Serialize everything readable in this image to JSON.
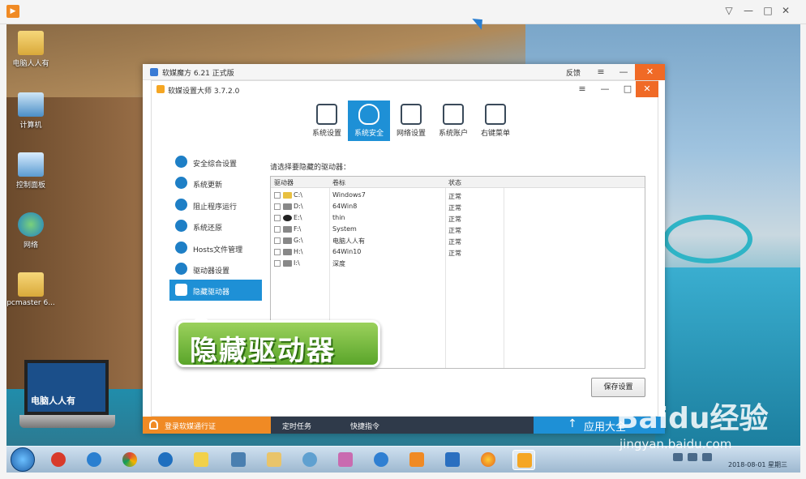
{
  "desktop": {
    "icons": [
      {
        "label": "电脑人人有"
      },
      {
        "label": "计算机"
      },
      {
        "label": "控制面板"
      },
      {
        "label": "网络"
      },
      {
        "label": "pcmaster 6..."
      }
    ],
    "laptop_text": "电脑人人有"
  },
  "app": {
    "title": "软媒魔方 6.21 正式版",
    "feedback": "反馈",
    "inner_title": "软媒设置大师 3.7.2.0",
    "tabs": [
      {
        "label": "系统设置"
      },
      {
        "label": "系统安全"
      },
      {
        "label": "网络设置"
      },
      {
        "label": "系统账户"
      },
      {
        "label": "右键菜单"
      }
    ],
    "sidebar": [
      {
        "label": "安全综合设置"
      },
      {
        "label": "系统更新"
      },
      {
        "label": "阻止程序运行"
      },
      {
        "label": "系统还原"
      },
      {
        "label": "Hosts文件管理"
      },
      {
        "label": "驱动器设置"
      },
      {
        "label": "隐藏驱动器"
      }
    ],
    "section_label": "请选择要隐藏的驱动器：",
    "table": {
      "headers": [
        "驱动器",
        "卷标",
        "状态"
      ],
      "rows": [
        {
          "drive": "C:\\",
          "label": "Windows7",
          "state": "正常"
        },
        {
          "drive": "D:\\",
          "label": "64Win8",
          "state": "正常"
        },
        {
          "drive": "E:\\",
          "label": "thin",
          "state": "正常"
        },
        {
          "drive": "F:\\",
          "label": "System",
          "state": "正常"
        },
        {
          "drive": "G:\\",
          "label": "电脑人人有",
          "state": "正常"
        },
        {
          "drive": "H:\\",
          "label": "64Win10",
          "state": "正常"
        },
        {
          "drive": "I:\\",
          "label": "深度",
          "state": ""
        }
      ]
    },
    "save_button": "保存设置",
    "callout": "隐藏驱动器",
    "footer": {
      "login": "登录软媒通行证",
      "timer": "定时任务",
      "shortcut": "快捷指令",
      "apps": "应用大全"
    }
  },
  "taskbar": {
    "clock": "2018-08-01 星期三"
  },
  "watermark": {
    "brand": "Baidu经验",
    "url": "jingyan.baidu.com"
  }
}
